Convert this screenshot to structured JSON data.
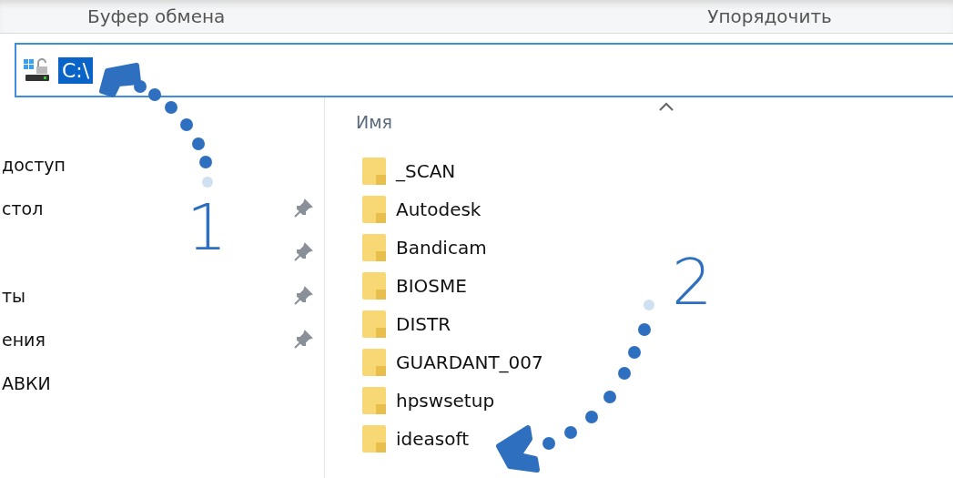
{
  "ribbon": {
    "groups": [
      "Буфер обмена",
      "Упорядочить"
    ]
  },
  "address_bar": {
    "path": "C:\\",
    "selected": true
  },
  "navigation": {
    "items": [
      {
        "label": "доступ",
        "pinned": false
      },
      {
        "label": "стол",
        "pinned": true
      },
      {
        "pinned": true
      },
      {
        "label": "ты",
        "pinned": true
      },
      {
        "label": "ения",
        "pinned": true
      },
      {
        "label": "АВКИ",
        "pinned": false
      }
    ]
  },
  "file_list": {
    "column_header": "Имя",
    "sorted_ascending": true,
    "items": [
      {
        "name": "_SCAN"
      },
      {
        "name": "Autodesk"
      },
      {
        "name": "Bandicam"
      },
      {
        "name": "BIOSME"
      },
      {
        "name": "DISTR"
      },
      {
        "name": "GUARDANT_007"
      },
      {
        "name": "hpswsetup"
      },
      {
        "name": "ideasoft"
      }
    ]
  },
  "annotations": [
    {
      "number": "1"
    },
    {
      "number": "2"
    }
  ]
}
